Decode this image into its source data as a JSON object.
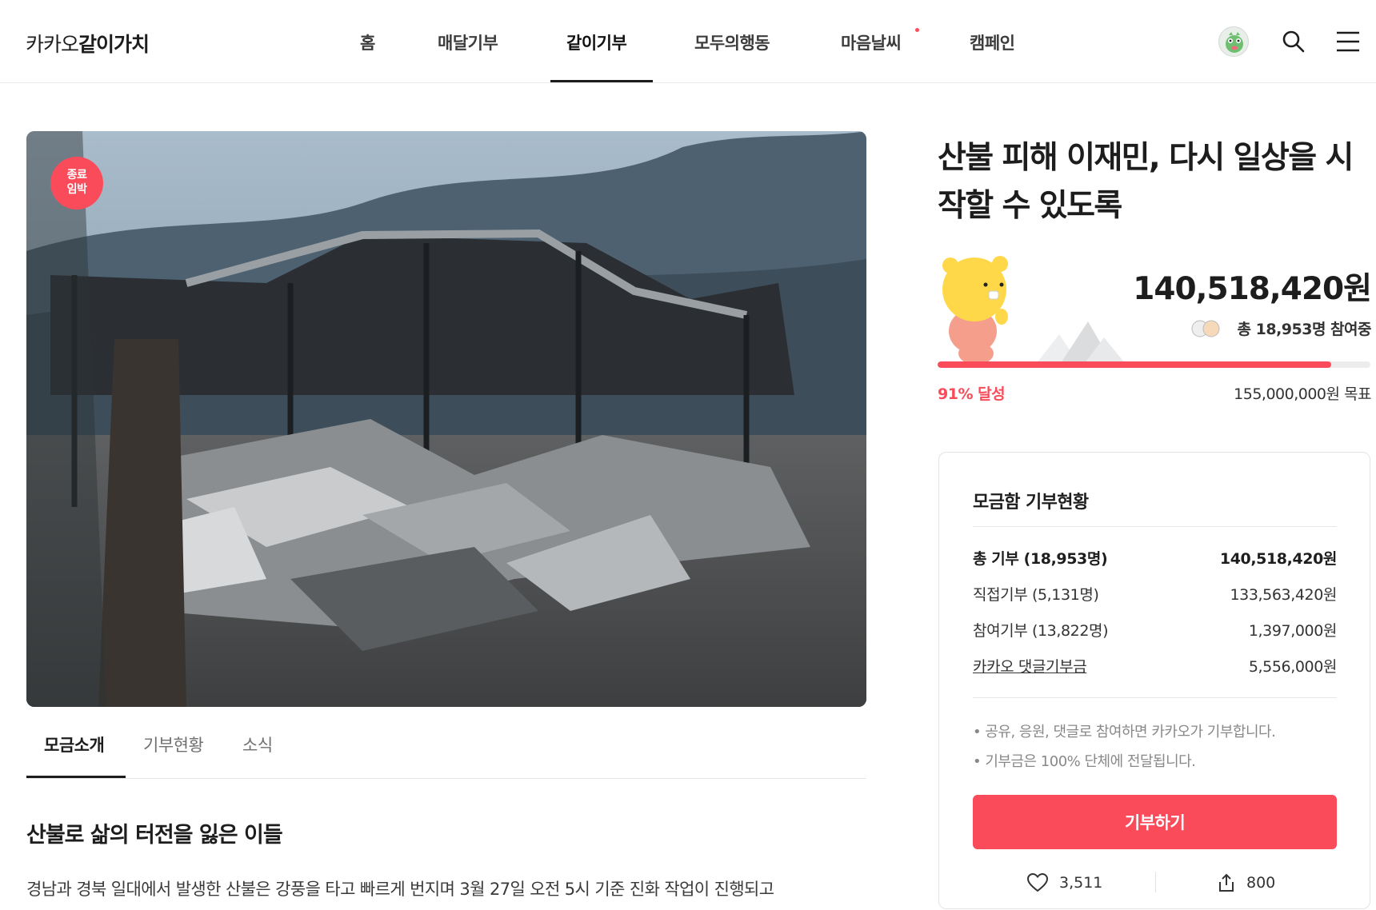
{
  "header": {
    "logo_light": "카카오",
    "logo_bold": "같이가치",
    "nav": [
      {
        "label": "홈"
      },
      {
        "label": "매달기부"
      },
      {
        "label": "같이기부"
      },
      {
        "label": "모두의행동"
      },
      {
        "label": "마음날씨"
      },
      {
        "label": "캠페인"
      }
    ],
    "active_nav": "같이기부",
    "icons": [
      "avatar",
      "search-icon",
      "menu-icon"
    ]
  },
  "hero": {
    "badge": "종료\n임박",
    "badge_line1": "종료",
    "badge_line2": "임박"
  },
  "tabs": [
    {
      "label": "모금소개"
    },
    {
      "label": "기부현황"
    },
    {
      "label": "소식"
    }
  ],
  "content": {
    "section_title": "산불로 삶의 터전을 잃은 이들",
    "body_text": "경남과 경북 일대에서 발생한 산불은  강풍을 타고 빠르게 번지며 3월 27일 오전 5시 기준 진화 작업이 진행되고"
  },
  "campaign": {
    "title": "산불 피해 이재민, 다시 일상을 시작할 수 있도록",
    "amount": "140,518,420원",
    "participants": "총 18,953명 참여중",
    "progress_percent": 91,
    "rate_label": "91% 달성",
    "goal": "155,000,000원 목표"
  },
  "summary": {
    "title": "모금함 기부현황",
    "rows": [
      {
        "label": "총 기부 (18,953명)",
        "value": "140,518,420원"
      },
      {
        "label": "직접기부 (5,131명)",
        "value": "133,563,420원"
      },
      {
        "label": "참여기부 (13,822명)",
        "value": "1,397,000원"
      },
      {
        "label": "카카오 댓글기부금",
        "value": "5,556,000원"
      }
    ],
    "notes": [
      "• 공유, 응원, 댓글로 참여하면 카카오가 기부합니다.",
      "• 기부금은 100% 단체에 전달됩니다."
    ],
    "donate_button": "기부하기",
    "likes": "3,511",
    "shares": "800"
  },
  "colors": {
    "accent": "#fa4b5a",
    "text": "#1d1d1d"
  }
}
